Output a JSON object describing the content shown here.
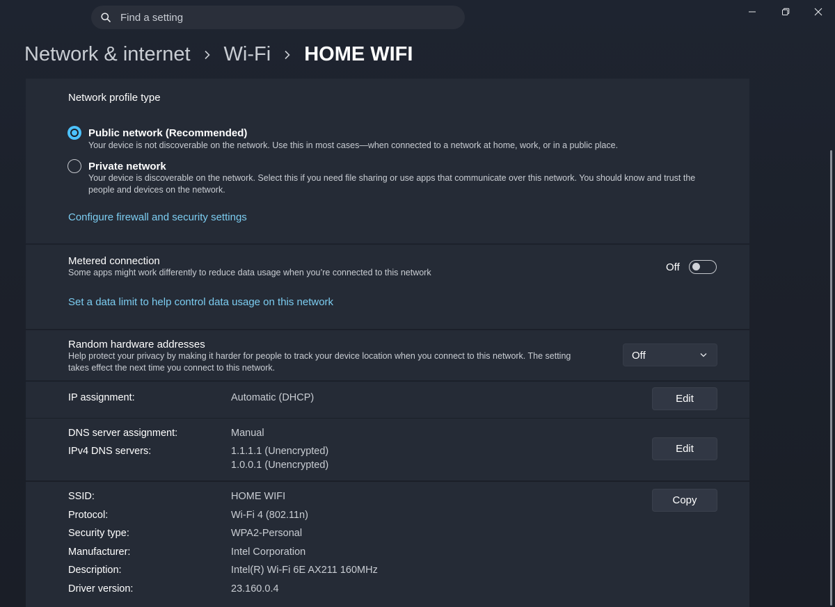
{
  "search": {
    "placeholder": "Find a setting"
  },
  "breadcrumb": {
    "items": [
      "Network & internet",
      "Wi-Fi"
    ],
    "current": "HOME WIFI"
  },
  "profile": {
    "title": "Network profile type",
    "options": [
      {
        "label": "Public network (Recommended)",
        "description": "Your device is not discoverable on the network. Use this in most cases—when connected to a network at home, work, or in a public place.",
        "selected": true
      },
      {
        "label": "Private network",
        "description_lines": [
          "Your device is discoverable on the network. Select this if you need file sharing or use apps that communicate over this network. You should know and trust the",
          "people and devices on the network."
        ],
        "selected": false
      }
    ],
    "firewall_link": "Configure firewall and security settings"
  },
  "metered": {
    "title": "Metered connection",
    "description": "Some apps might work differently to reduce data usage when you’re connected to this network",
    "state_label": "Off",
    "enabled": false,
    "data_limit_link": "Set a data limit to help control data usage on this network"
  },
  "random_hw": {
    "title": "Random hardware addresses",
    "description_lines": [
      "Help protect your privacy by making it harder for people to track your device location when you connect to this network. The setting",
      "takes effect the next time you connect to this network."
    ],
    "selected": "Off"
  },
  "ip": {
    "label": "IP assignment:",
    "value": "Automatic (DHCP)",
    "button": "Edit"
  },
  "dns": {
    "assignment_label": "DNS server assignment:",
    "assignment_value": "Manual",
    "servers_label": "IPv4 DNS servers:",
    "servers": [
      "1.1.1.1 (Unencrypted)",
      "1.0.0.1 (Unencrypted)"
    ],
    "button": "Edit"
  },
  "properties": {
    "button": "Copy",
    "rows": [
      {
        "label": "SSID:",
        "value": "HOME WIFI"
      },
      {
        "label": "Protocol:",
        "value": "Wi-Fi 4 (802.11n)"
      },
      {
        "label": "Security type:",
        "value": "WPA2-Personal"
      },
      {
        "label": "Manufacturer:",
        "value": "Intel Corporation"
      },
      {
        "label": "Description:",
        "value": "Intel(R) Wi-Fi 6E AX211 160MHz"
      },
      {
        "label": "Driver version:",
        "value": "23.160.0.4"
      }
    ]
  },
  "colors": {
    "accent": "#4cc2ff",
    "link": "#7ccdf1",
    "card": "#252b36",
    "background": "#1c212b"
  },
  "icons": {
    "search": "search-icon",
    "minimize": "minimize-icon",
    "restore": "restore-icon",
    "close": "close-icon",
    "breadcrumb_separator": "chevron-right-icon",
    "dropdown": "chevron-down-icon"
  }
}
